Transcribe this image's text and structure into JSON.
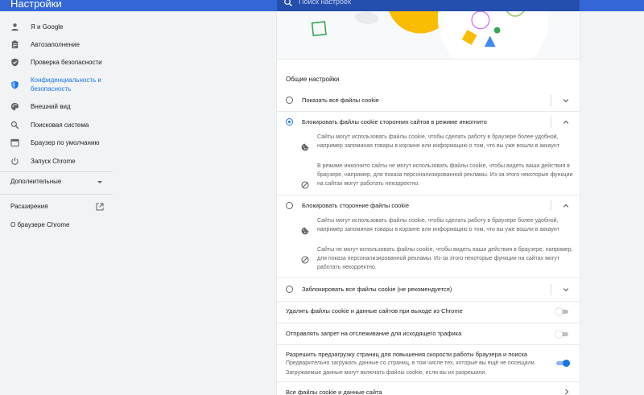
{
  "header": {
    "title": "Настройки",
    "search_placeholder": "Поиск настроек"
  },
  "sidebar": {
    "items": [
      {
        "label": "Я и Google",
        "icon": "person-icon"
      },
      {
        "label": "Автозаполнение",
        "icon": "clipboard-icon"
      },
      {
        "label": "Проверка безопасности",
        "icon": "shield-check-icon"
      },
      {
        "label_line1": "Конфиденциальность и",
        "label_line2": "безопасность",
        "icon": "shield-icon",
        "active": true
      },
      {
        "label": "Внешний вид",
        "icon": "palette-icon"
      },
      {
        "label": "Поисковая система",
        "icon": "search-icon"
      },
      {
        "label": "Браузер по умолчанию",
        "icon": "browser-icon"
      },
      {
        "label": "Запуск Chrome",
        "icon": "power-icon"
      }
    ],
    "advanced": "Дополнительные",
    "extensions": "Расширения",
    "about": "О браузере Chrome"
  },
  "main": {
    "section_title": "Общие настройки",
    "options": [
      {
        "label": "Показать все файлы cookie",
        "checked": false
      },
      {
        "label": "Блокировать файлы cookie сторонних сайтов в режиме инкогнито",
        "checked": true,
        "desc1": "Сайты могут использовать файлы cookie, чтобы сделать работу в браузере более удобной, например запоминая товары в корзине или информацию о том, что вы уже вошли в аккаунт",
        "desc2": "В режиме инкогнито сайты не могут использовать файлы cookie, чтобы видеть ваши действия в браузере, например, для показа персонализированной рекламы. Из-за этого некоторые функции на сайтах могут работать некорректно."
      },
      {
        "label": "Блокировать сторонние файлы cookie",
        "checked": false,
        "desc1": "Сайты могут использовать файлы cookie, чтобы сделать работу в браузере более удобной, например запоминая товары в корзине или информацию о том, что вы уже вошли в аккаунт",
        "desc2": "Сайты не могут использовать файлы cookie, чтобы видеть ваши действия в браузере, например, для показа персонализированной рекламы. Из-за этого некоторые функции на сайтах могут работать некорректно."
      },
      {
        "label": "Заблокировать все файлы cookie (не рекомендуется)",
        "checked": false
      }
    ],
    "toggles": [
      {
        "label": "Удалять файлы cookie и данные сайтов при выходе из Chrome",
        "on": false
      },
      {
        "label": "Отправлять запрет на отслеживание для исходящего трафика",
        "on": false
      },
      {
        "label": "Разрешить предзагрузку страниц для повышения скорости работы браузера и поиска",
        "sub": "Предварительно загружать данные со страниц, в том числе тех, которые вы ещё не посещали. Загружаемые данные могут включать файлы cookie, если вы их разрешили.",
        "on": true
      }
    ],
    "all_cookies_link": "Все файлы cookie и данные сайта"
  },
  "colors": {
    "header_bg": "#3367d6",
    "accent": "#1a73e8",
    "page_bg": "#f1f3f4"
  }
}
